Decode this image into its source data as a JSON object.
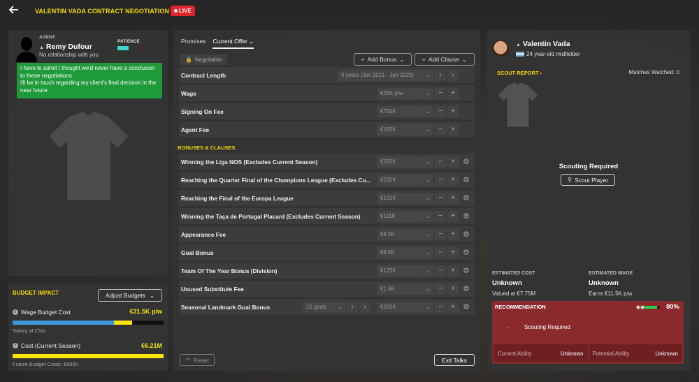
{
  "header": {
    "title": "VALENTIN VADA CONTRACT NEGOTIATION",
    "live_label": "LIVE"
  },
  "agent": {
    "role_label": "AGENT",
    "name": "Remy Dufour",
    "relationship": "No relationship with you",
    "patience_label": "PATIENCE",
    "message": "I have to admit I thought we'd never have a conclusion to these negotiations.\nI'll be in touch regarding my client's final decision in the near future."
  },
  "budget": {
    "title": "BUDGET IMPACT",
    "adjust_label": "Adjust Budgets",
    "wage_label": "Wage Budget Cost",
    "wage_value": "€31.5K p/w",
    "wage_sub": "Salary at Club",
    "cost_label": "Cost (Current Season)",
    "cost_value": "€6.21M",
    "cost_sub": "Future Budget Costs: €696K"
  },
  "offer": {
    "tabs": [
      "Promises",
      "Current Offer"
    ],
    "negotiable_label": "Negotiable",
    "add_bonus_label": "Add Bonus",
    "add_clause_label": "Add Clause",
    "contract_length": {
      "label": "Contract Length",
      "value": "4 years (Jan 2021 - Jun 2025)"
    },
    "wage": {
      "label": "Wage",
      "value": "€25K p/w"
    },
    "signing_fee": {
      "label": "Signing On Fee",
      "value": "€750K"
    },
    "agent_fee": {
      "label": "Agent Fee",
      "value": "€165K"
    },
    "section_label": "BONUSES & CLAUSES",
    "bonuses": [
      {
        "label": "Winning the Liga NOS (Excludes Current Season)",
        "value": "€250K"
      },
      {
        "label": "Reaching the Quarter Final of the Champions League (Excludes Cu...",
        "value": "€230K"
      },
      {
        "label": "Reaching the Final of the Europa League",
        "value": "€150K"
      },
      {
        "label": "Winning the Taça de Portugal Placard (Excludes Current Season)",
        "value": "€115K"
      },
      {
        "label": "Appearance Fee",
        "value": "€6.5K"
      },
      {
        "label": "Goal Bonus",
        "value": "€6.5K"
      },
      {
        "label": "Team Of The Year Bonus (Division)",
        "value": "€125K"
      },
      {
        "label": "Unused Substitute Fee",
        "value": "€1.6K"
      },
      {
        "label": "Seasonal Landmark Goal Bonus",
        "value": "€250K",
        "goals": "15 goals"
      }
    ],
    "reset_label": "Reset",
    "exit_label": "Exit Talks"
  },
  "player": {
    "name": "Valentin Vada",
    "description": "24 year-old midfielder",
    "scout_report_label": "SCOUT REPORT",
    "matches_watched": "Matches Watched: 0",
    "scouting_required": "Scouting Required",
    "scout_button": "Scout Player",
    "est_cost_label": "ESTIMATED COST",
    "est_cost_value": "Unknown",
    "est_cost_sub": "Valued at €7.75M",
    "est_wage_label": "ESTIMATED WAGE",
    "est_wage_value": "Unknown",
    "est_wage_sub": "Earns €11.5K p/w",
    "recommendation": {
      "title": "RECOMMENDATION",
      "percent": "80%",
      "progress": 0.8,
      "dash": "-",
      "text": "Scouting Required",
      "current_ability_label": "Current Ability",
      "current_ability_value": "Unknown",
      "potential_ability_label": "Potential Ability",
      "potential_ability_value": "Unknown"
    }
  },
  "colors": {
    "accent_yellow": "#f5d90a",
    "live_red": "#e0252e",
    "message_green": "#1f9a3b",
    "recommendation_red": "#8b2a2d",
    "patience_teal": "#3ed7c8",
    "wage_bar_blue": "#3a9ad9",
    "wage_bar_yellow": "#f5e30a"
  },
  "icons": {
    "back": "arrow-left-icon",
    "lock": "lock-icon",
    "plus": "plus-icon",
    "minus": "minus-icon",
    "chevron_down": "chevron-down-icon",
    "chevron_left": "chevron-left-icon",
    "chevron_right": "chevron-right-icon",
    "remove": "remove-circle-icon",
    "search": "search-icon",
    "binoculars": "binoculars-icon",
    "info": "info-icon",
    "reset": "undo-icon"
  }
}
